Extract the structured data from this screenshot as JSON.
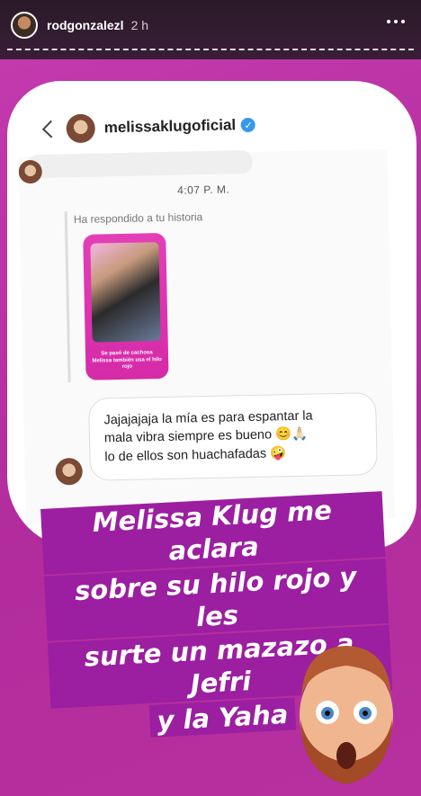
{
  "story": {
    "username": "rodgonzalezl",
    "time": "2 h"
  },
  "dm": {
    "username": "melissaklugoficial",
    "timestamp": "4:07 P. M.",
    "reply_label": "Ha respondido a tu historia",
    "story_thumb_text": "Se pasó de cachosa Melissa también usa el hilo rojo",
    "message_lines": [
      "Jajajajaja la mía es para espantar la",
      "mala vibra siempre es bueno 😊🙏🏻",
      "lo de ellos son huachafadas 🤪"
    ]
  },
  "caption": {
    "lines": [
      "Melissa Klug me aclara",
      "sobre su hilo rojo  y les",
      "surte un mazazo a Jefri",
      "y la Yaha"
    ]
  },
  "colors": {
    "background": "#b72da5",
    "caption_highlight": "#9b1fa0",
    "verified": "#3897f0"
  },
  "icons": [
    "more-icon",
    "back-icon",
    "verified-icon"
  ]
}
